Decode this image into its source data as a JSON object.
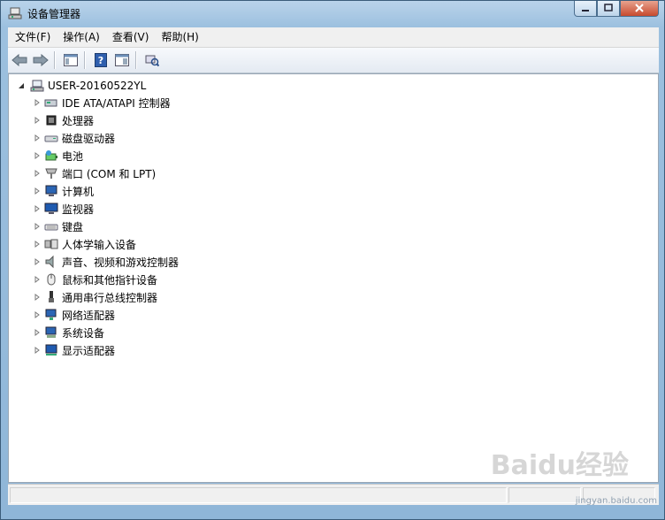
{
  "window": {
    "title": "设备管理器"
  },
  "menu": [
    {
      "label": "文件(F)"
    },
    {
      "label": "操作(A)"
    },
    {
      "label": "查看(V)"
    },
    {
      "label": "帮助(H)"
    }
  ],
  "tree": {
    "root": "USER-20160522YL",
    "nodes": [
      {
        "label": "IDE ATA/ATAPI 控制器",
        "icon": "ide-controller-icon"
      },
      {
        "label": "处理器",
        "icon": "processor-icon"
      },
      {
        "label": "磁盘驱动器",
        "icon": "disk-drive-icon"
      },
      {
        "label": "电池",
        "icon": "battery-icon"
      },
      {
        "label": "端口 (COM 和 LPT)",
        "icon": "port-icon"
      },
      {
        "label": "计算机",
        "icon": "computer-icon"
      },
      {
        "label": "监视器",
        "icon": "monitor-icon"
      },
      {
        "label": "键盘",
        "icon": "keyboard-icon"
      },
      {
        "label": "人体学输入设备",
        "icon": "hid-icon"
      },
      {
        "label": "声音、视频和游戏控制器",
        "icon": "speaker-icon"
      },
      {
        "label": "鼠标和其他指针设备",
        "icon": "mouse-icon"
      },
      {
        "label": "通用串行总线控制器",
        "icon": "usb-icon"
      },
      {
        "label": "网络适配器",
        "icon": "network-adapter-icon"
      },
      {
        "label": "系统设备",
        "icon": "system-device-icon"
      },
      {
        "label": "显示适配器",
        "icon": "display-adapter-icon"
      }
    ]
  },
  "watermark": {
    "main": "Baidu经验",
    "sub": "jingyan.baidu.com"
  }
}
